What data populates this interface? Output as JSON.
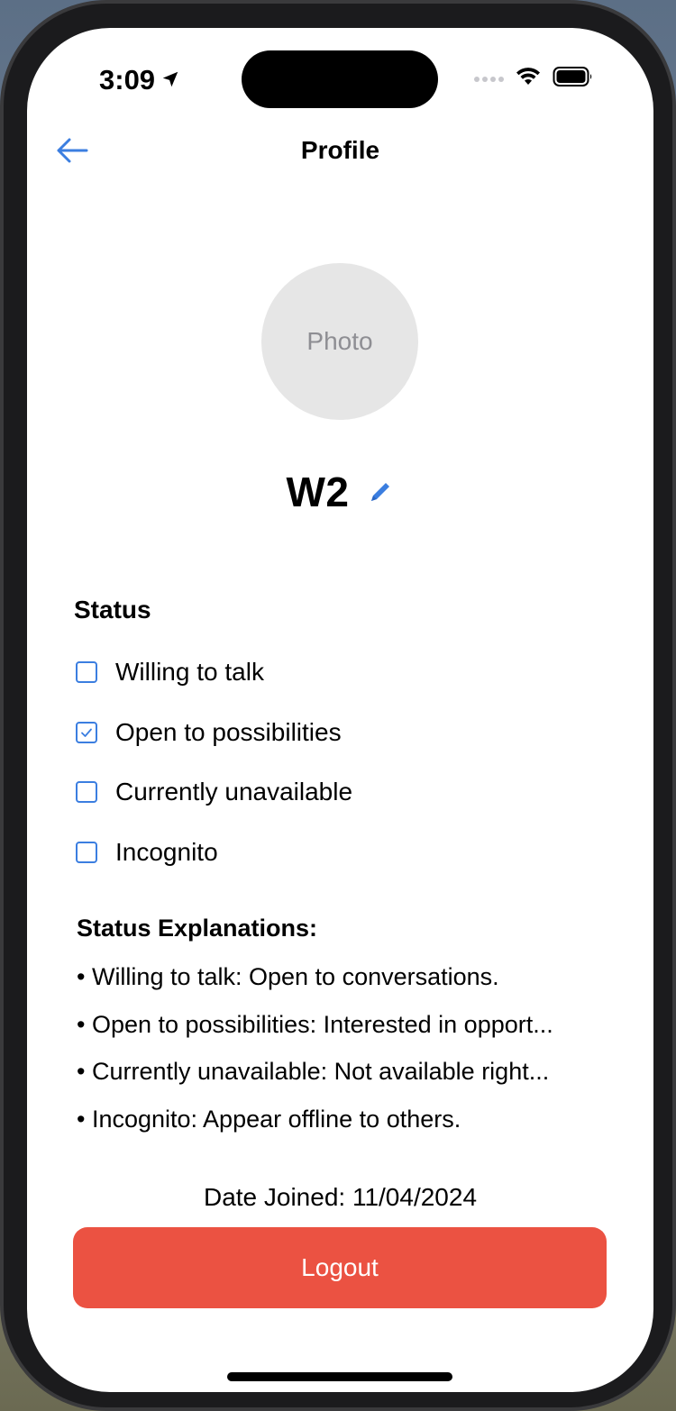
{
  "status_bar": {
    "time": "3:09",
    "location_icon": "location-arrow-icon",
    "wifi_icon": "wifi-icon",
    "battery_icon": "battery-icon"
  },
  "nav": {
    "title": "Profile",
    "back_icon": "back-arrow-icon"
  },
  "profile": {
    "photo_placeholder": "Photo",
    "name": "W2",
    "edit_icon": "pencil-icon"
  },
  "status": {
    "title": "Status",
    "options": [
      {
        "label": "Willing to talk",
        "checked": false
      },
      {
        "label": "Open to possibilities",
        "checked": true
      },
      {
        "label": "Currently unavailable",
        "checked": false
      },
      {
        "label": "Incognito",
        "checked": false
      }
    ]
  },
  "explanations": {
    "title": "Status Explanations:",
    "items": [
      "• Willing to talk: Open to conversations.",
      "• Open to possibilities: Interested in opport...",
      "• Currently unavailable: Not available right...",
      "• Incognito: Appear offline to others."
    ]
  },
  "footer": {
    "date_joined": "Date Joined: 11/04/2024",
    "logout_label": "Logout"
  },
  "colors": {
    "accent": "#3b7ee0",
    "logout": "#eb5242",
    "photo_bg": "#e6e6e6",
    "placeholder_text": "#8e8e93"
  }
}
